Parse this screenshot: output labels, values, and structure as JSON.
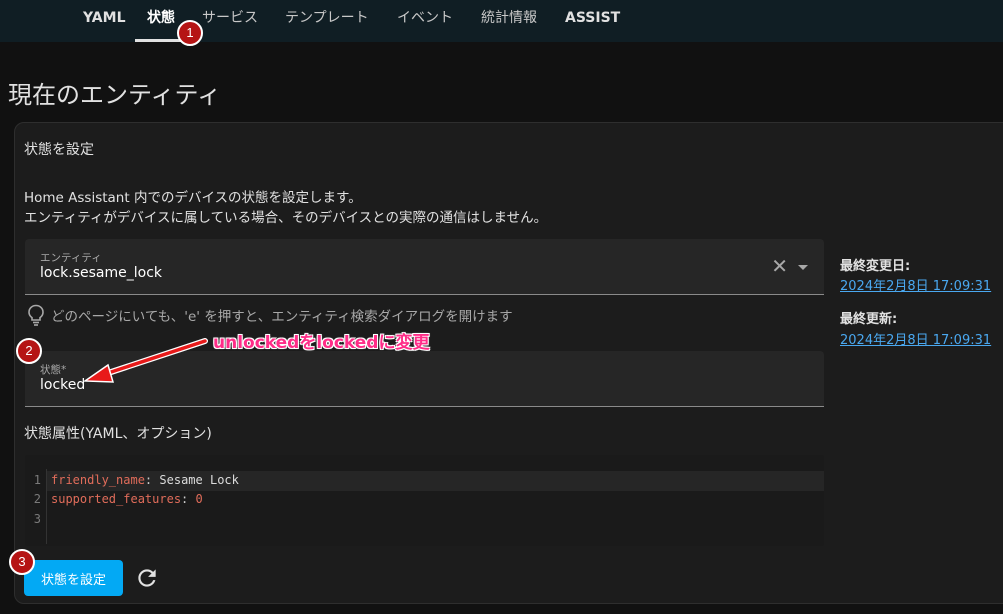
{
  "tabs": [
    "YAML",
    "状態",
    "サービス",
    "テンプレート",
    "イベント",
    "統計情報",
    "ASSIST"
  ],
  "page_title": "現在のエンティティ",
  "card": {
    "title": "状態を設定",
    "description_line1": "Home Assistant 内でのデバイスの状態を設定します。",
    "description_line2": "エンティティがデバイスに属している場合、そのデバイスとの実際の通信はしません。"
  },
  "entity_field": {
    "label": "エンティティ",
    "value": "lock.sesame_lock"
  },
  "hint": "どのページにいても、'e' を押すと、エンティティ検索ダイアログを開けます",
  "state_field": {
    "label": "状態*",
    "value": "locked"
  },
  "attributes_title": "状態属性(YAML、オプション)",
  "editor": {
    "line_numbers": [
      "1",
      "2",
      "3"
    ],
    "line1_key": "friendly_name",
    "line1_value": "Sesame Lock",
    "line2_key": "supported_features",
    "line2_value": "0",
    "colon": ":"
  },
  "set_button_label": "状態を設定",
  "sidebar": {
    "last_changed_label": "最終変更日:",
    "last_changed_value": "2024年2月8日 17:09:31",
    "last_updated_label": "最終更新:",
    "last_updated_value": "2024年2月8日 17:09:31"
  },
  "annotations": {
    "marker1": "1",
    "marker2": "2",
    "marker3": "3",
    "callout": "unlockedをlockedに変更"
  },
  "colors": {
    "accent": "#03a9f4",
    "link": "#4aa8f0",
    "marker": "#b51414",
    "callout": "#ff2d88"
  },
  "icons": {
    "clear": "close-icon",
    "dropdown": "chevron-down-icon",
    "hint": "lightbulb-icon",
    "refresh": "refresh-icon"
  }
}
